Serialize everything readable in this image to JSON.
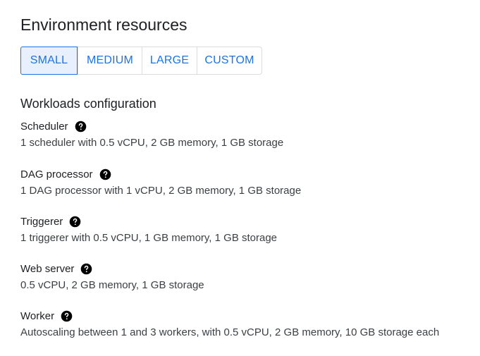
{
  "page_title": "Environment resources",
  "size_options": [
    {
      "label": "SMALL",
      "selected": true
    },
    {
      "label": "MEDIUM",
      "selected": false
    },
    {
      "label": "LARGE",
      "selected": false
    },
    {
      "label": "CUSTOM",
      "selected": false
    }
  ],
  "workloads": {
    "heading": "Workloads configuration",
    "items": [
      {
        "name": "Scheduler",
        "description": "1 scheduler with 0.5 vCPU, 2 GB memory, 1 GB storage",
        "icon": "help-icon"
      },
      {
        "name": "DAG processor",
        "description": "1 DAG processor with 1 vCPU, 2 GB memory, 1 GB storage",
        "icon": "help-icon"
      },
      {
        "name": "Triggerer",
        "description": "1 triggerer with 0.5 vCPU, 1 GB memory, 1 GB storage",
        "icon": "help-icon"
      },
      {
        "name": "Web server",
        "description": "0.5 vCPU, 2 GB memory, 1 GB storage",
        "icon": "help-icon"
      },
      {
        "name": "Worker",
        "description": "Autoscaling between 1 and 3 workers, with 0.5 vCPU, 2 GB memory, 10 GB storage each",
        "icon": "help-icon"
      }
    ]
  },
  "colors": {
    "accent": "#1a73e8",
    "selected_bg": "#e8f0fe",
    "border": "#dadce0",
    "text": "#202124"
  }
}
